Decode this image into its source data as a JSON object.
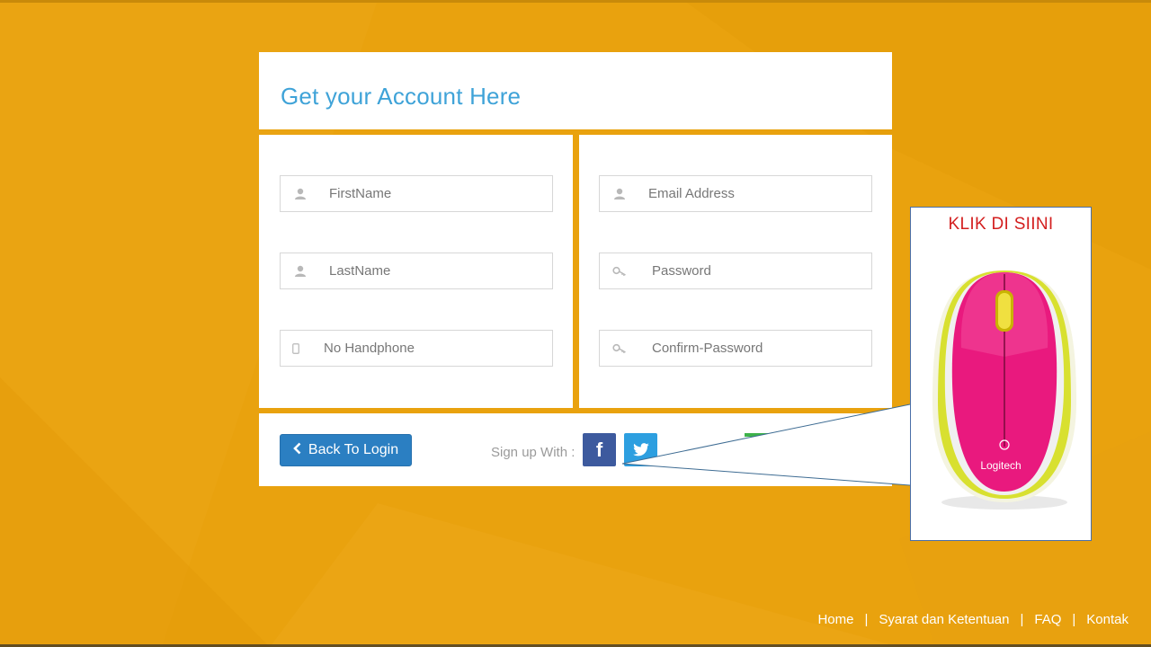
{
  "header": {
    "title": "Get your Account Here"
  },
  "form": {
    "first_name": {
      "placeholder": "FirstName",
      "icon": "user-icon"
    },
    "last_name": {
      "placeholder": "LastName",
      "icon": "user-icon"
    },
    "phone": {
      "placeholder": "No Handphone",
      "icon": "phone-icon"
    },
    "email": {
      "placeholder": "Email Address",
      "icon": "user-icon"
    },
    "password": {
      "placeholder": "Password",
      "icon": "key-icon"
    },
    "confirm_password": {
      "placeholder": "Confirm-Password",
      "icon": "key-icon"
    }
  },
  "actions": {
    "back_label": "Back To Login",
    "signup_label": "Sign up With :",
    "facebook_glyph": "f"
  },
  "ad": {
    "title": "KLIK DI SIINI",
    "brand": "Logitech",
    "colors": {
      "primary": "#E9197E",
      "accent": "#D5DE2A"
    }
  },
  "footer": {
    "links": [
      "Home",
      "Syarat dan Ketentuan",
      "FAQ",
      "Kontak"
    ]
  },
  "colors": {
    "background": "#E9A20E",
    "title": "#3FA3D8",
    "button": "#2B7FC2",
    "facebook": "#3D5A9E",
    "twitter": "#2D9FE0"
  }
}
